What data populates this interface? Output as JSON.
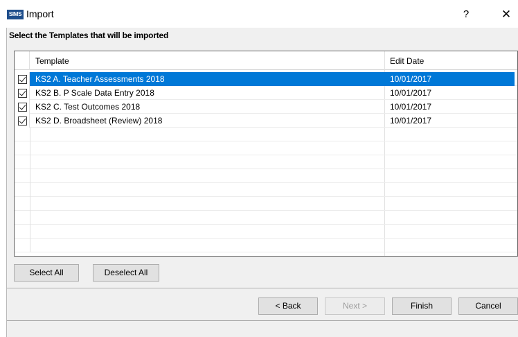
{
  "window": {
    "logo": "SIMS",
    "title": "Import",
    "help_label": "?",
    "close_label": "✕"
  },
  "heading": "Select the Templates that will be imported",
  "grid": {
    "columns": [
      "Template",
      "Edit Date"
    ],
    "rows": [
      {
        "checked": true,
        "name": "KS2 A. Teacher Assessments 2018",
        "date": "10/01/2017",
        "selected": true
      },
      {
        "checked": true,
        "name": "KS2 B. P Scale Data Entry 2018",
        "date": "10/01/2017",
        "selected": false
      },
      {
        "checked": true,
        "name": "KS2 C. Test Outcomes 2018",
        "date": "10/01/2017",
        "selected": false
      },
      {
        "checked": true,
        "name": "KS2 D. Broadsheet (Review) 2018",
        "date": "10/01/2017",
        "selected": false
      }
    ]
  },
  "buttons": {
    "select_all": "Select All",
    "deselect_all": "Deselect All",
    "back": "< Back",
    "next": "Next >",
    "finish": "Finish",
    "cancel": "Cancel"
  }
}
